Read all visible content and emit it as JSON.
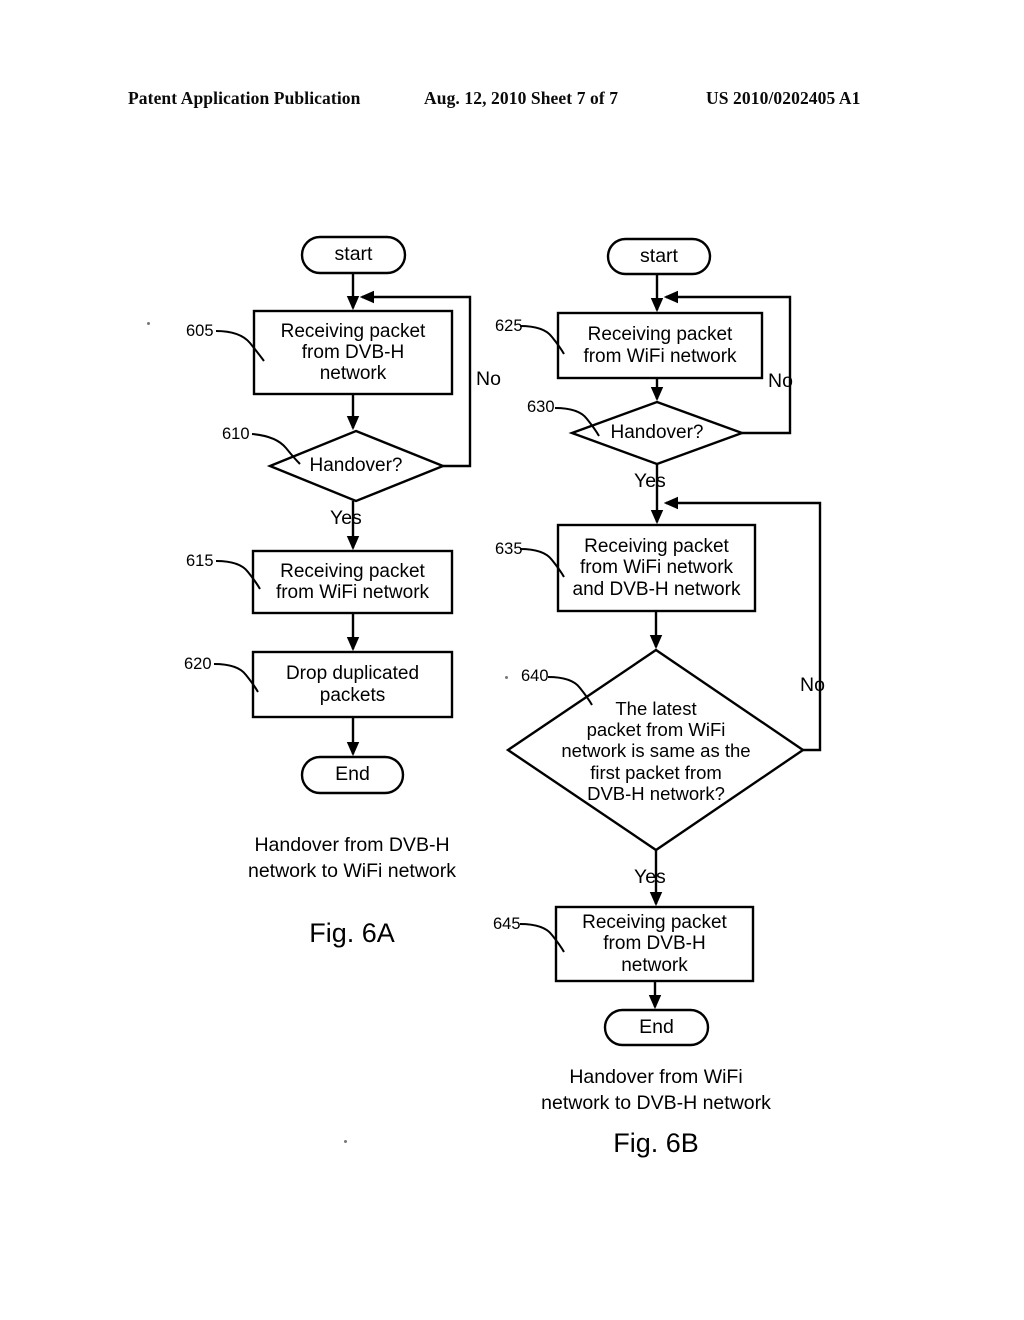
{
  "header": {
    "publication": "Patent Application Publication",
    "date_sheet": "Aug. 12, 2010  Sheet 7 of 7",
    "patent_number": "US 2010/0202405 A1"
  },
  "figures": [
    {
      "id": "fig-6a",
      "label": "Fig. 6A",
      "caption": "Handover from DVB-H\nnetwork to WiFi network",
      "nodes": [
        {
          "ref": "",
          "type": "terminal",
          "text": "start"
        },
        {
          "ref": "605",
          "type": "process",
          "text": "Receiving packet\nfrom DVB-H\nnetwork"
        },
        {
          "ref": "610",
          "type": "decision",
          "text": "Handover?"
        },
        {
          "ref": "615",
          "type": "process",
          "text": "Receiving packet\nfrom WiFi network"
        },
        {
          "ref": "620",
          "type": "process",
          "text": "Drop duplicated\npackets"
        },
        {
          "ref": "",
          "type": "terminal",
          "text": "End"
        }
      ],
      "edge_labels": [
        {
          "name": "no",
          "text": "No"
        },
        {
          "name": "yes",
          "text": "Yes"
        }
      ]
    },
    {
      "id": "fig-6b",
      "label": "Fig. 6B",
      "caption": "Handover from WiFi\nnetwork to DVB-H network",
      "nodes": [
        {
          "ref": "",
          "type": "terminal",
          "text": "start"
        },
        {
          "ref": "625",
          "type": "process",
          "text": "Receiving packet\nfrom WiFi network"
        },
        {
          "ref": "630",
          "type": "decision",
          "text": "Handover?"
        },
        {
          "ref": "635",
          "type": "process",
          "text": "Receiving packet\nfrom WiFi network\nand DVB-H network"
        },
        {
          "ref": "640",
          "type": "decision",
          "text": "The latest\npacket from WiFi\nnetwork is same as the\nfirst packet from\nDVB-H network?"
        },
        {
          "ref": "645",
          "type": "process",
          "text": "Receiving packet\nfrom  DVB-H\nnetwork"
        },
        {
          "ref": "",
          "type": "terminal",
          "text": "End"
        }
      ],
      "edge_labels": [
        {
          "name": "no-630",
          "text": "No"
        },
        {
          "name": "yes-630",
          "text": "Yes"
        },
        {
          "name": "no-640",
          "text": "No"
        },
        {
          "name": "yes-640",
          "text": "Yes"
        }
      ]
    }
  ],
  "colors": {
    "ink": "#000000",
    "paper": "#ffffff"
  }
}
